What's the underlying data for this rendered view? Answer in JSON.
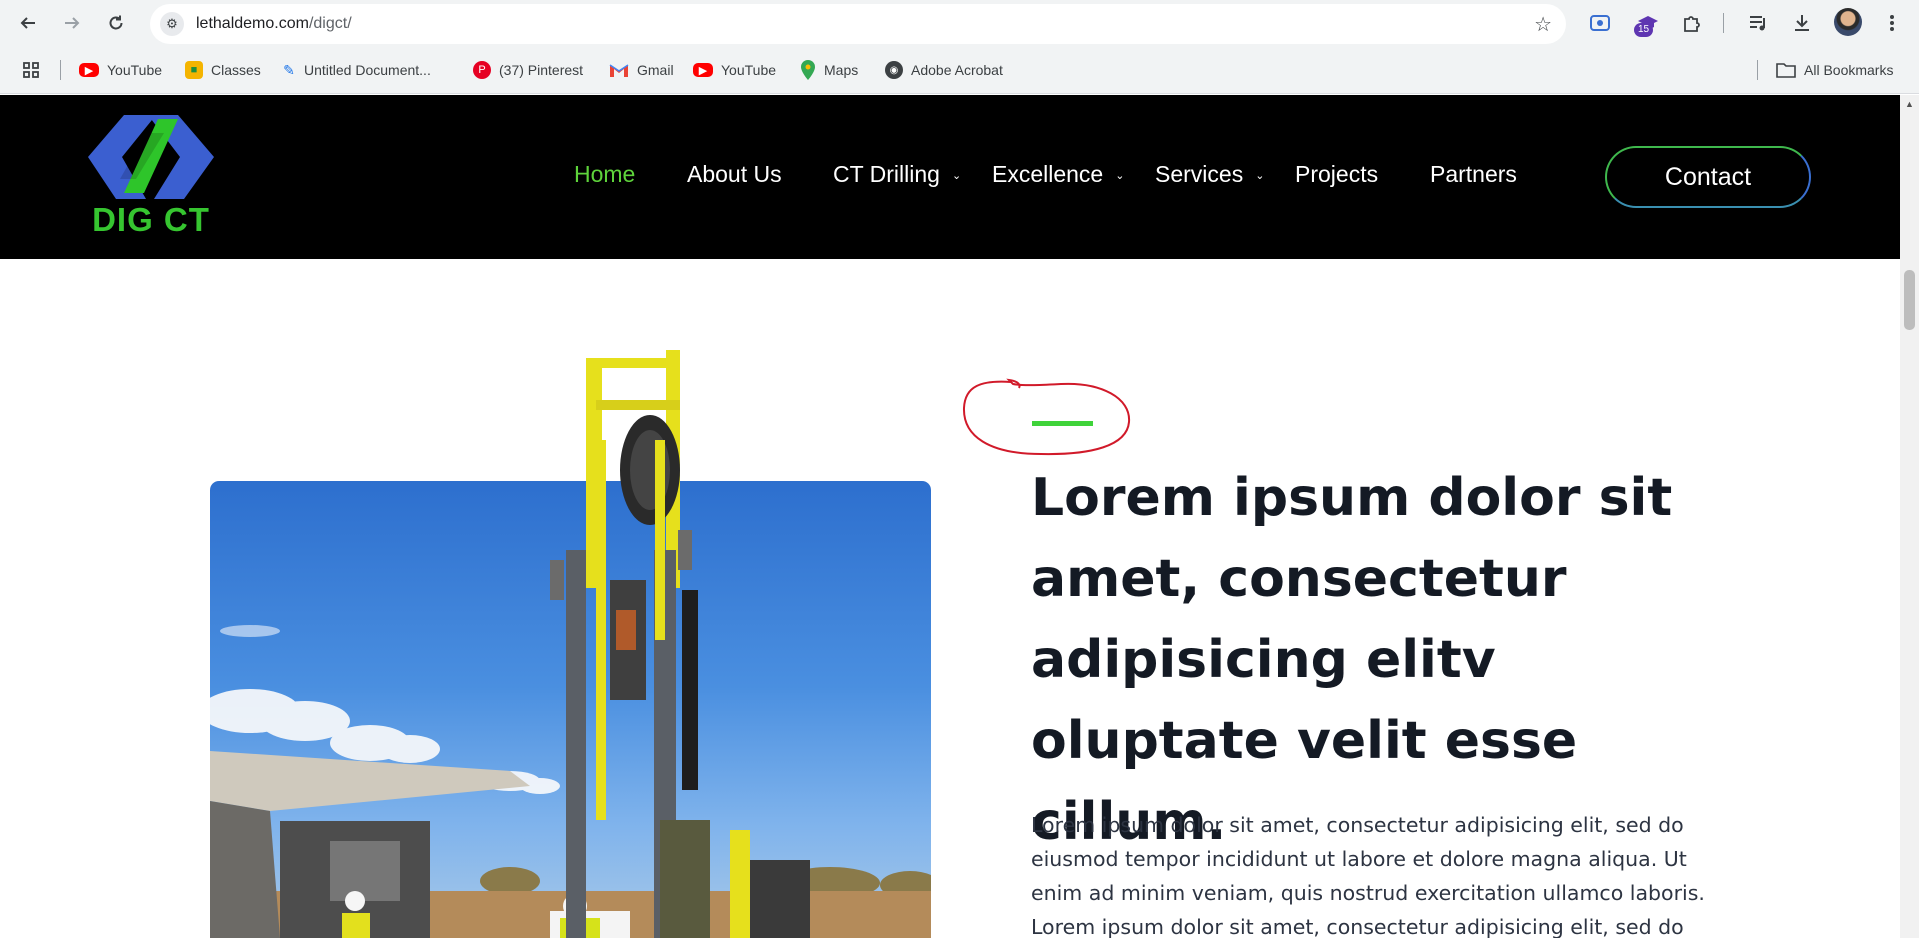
{
  "browser": {
    "url_host": "lethaldemo.com",
    "url_path": "/digct/",
    "extension_badge": "15",
    "bookmarks": [
      {
        "label": "YouTube",
        "icon": "youtube-icon"
      },
      {
        "label": "Classes",
        "icon": "classes-icon"
      },
      {
        "label": "Untitled Document...",
        "icon": "document-icon"
      },
      {
        "label": "(37) Pinterest",
        "icon": "pinterest-icon"
      },
      {
        "label": "Gmail",
        "icon": "gmail-icon"
      },
      {
        "label": "YouTube",
        "icon": "youtube-icon"
      },
      {
        "label": "Maps",
        "icon": "maps-icon"
      },
      {
        "label": "Adobe Acrobat",
        "icon": "acrobat-icon"
      }
    ],
    "all_bookmarks": "All Bookmarks"
  },
  "site": {
    "logo_text": "DIG CT",
    "nav": [
      {
        "label": "Home",
        "active": true
      },
      {
        "label": "About Us"
      },
      {
        "label": "CT Drilling",
        "dropdown": true
      },
      {
        "label": "Excellence",
        "dropdown": true
      },
      {
        "label": "Services",
        "dropdown": true
      },
      {
        "label": "Projects"
      },
      {
        "label": "Partners"
      }
    ],
    "contact_label": "Contact"
  },
  "content": {
    "headline": "Lorem ipsum dolor sit amet, consectetur adipisicing elitv oluptate velit esse cillum.",
    "paragraph": "Lorem ipsum dolor sit amet, consectetur adipisicing elit, sed do eiusmod tempor incididunt ut labore et dolore magna aliqua. Ut enim ad minim veniam, quis nostrud exercitation ullamco laboris. Lorem ipsum dolor sit amet, consectetur adipisicing elit, sed do"
  },
  "colors": {
    "accent_green": "#3fd33a",
    "nav_active": "#5ed33b",
    "header_bg": "#000000",
    "annotation_red": "#d11a2a"
  }
}
